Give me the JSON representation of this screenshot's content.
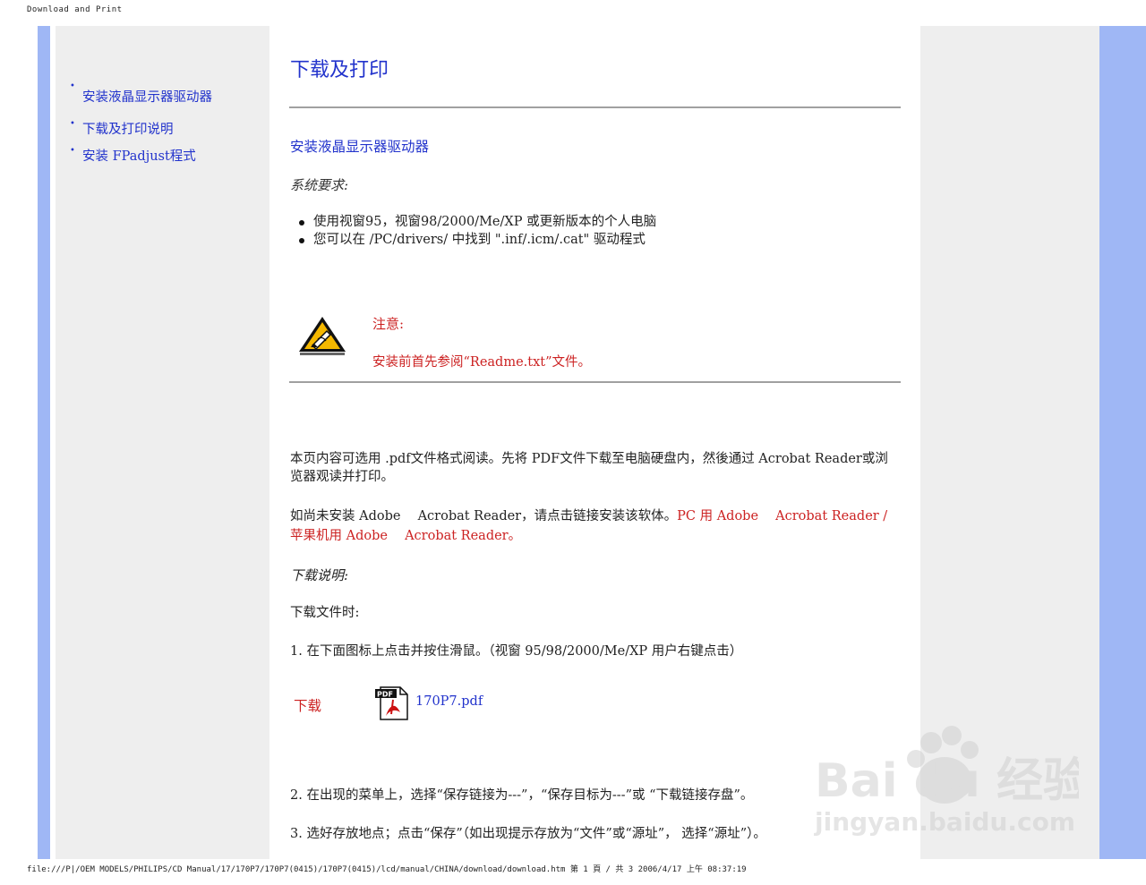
{
  "print_header": "Download and Print",
  "print_footer": "file:///P|/OEM MODELS/PHILIPS/CD Manual/17/170P7/170P7(0415)/170P7(0415)/lcd/manual/CHINA/download/download.htm 第 1 頁 / 共 3 2006/4/17 上午 08:37:19",
  "sidebar": {
    "items": [
      {
        "label": "安装液晶显示器驱动器"
      },
      {
        "label": "下载及打印说明"
      },
      {
        "label": "安装 FPadjust程式"
      }
    ]
  },
  "main": {
    "title": "下载及打印",
    "section_link": "安装液晶显示器驱动器",
    "system_req_label": "系统要求:",
    "requirements": [
      "使用视窗95，视窗98/2000/Me/XP 或更新版本的个人电脑",
      "您可以在 /PC/drivers/ 中找到 \".inf/.icm/.cat\" 驱动程式"
    ],
    "note_title": "注意:",
    "note_text": "安装前首先参阅“Readme.txt”文件。",
    "pdf_intro": "本页内容可选用 .pdf文件格式阅读。先将 PDF文件下载至电脑硬盘内，然後通过 Acrobat Reader或浏览器观读并打印。",
    "install_prefix": "如尚未安装 Adobe　 Acrobat Reader，请点击链接安装该软体。",
    "install_links": "PC 用 Adobe　 Acrobat Reader / 苹果机用 Adobe　 Acrobat Reader。",
    "download_notes_label": "下载说明:",
    "download_when": "下载文件时:",
    "step1": "1. 在下面图标上点击并按住滑鼠。（视窗 95/98/2000/Me/XP 用户右键点击）",
    "download_label": "下载",
    "pdf_filename": "170P7.pdf",
    "step2": "2. 在出现的菜单上，选择“保存链接为---”，“保存目标为---”或 “下载链接存盘”。",
    "step3": "3. 选好存放地点；点击“保存”（如出现提示存放为“文件”或“源址”， 选择“源址”）。"
  },
  "watermark": {
    "brand": "Bai du 经验",
    "url": "jingyan.baidu.com"
  },
  "colors": {
    "link_blue": "#2233cc",
    "note_red": "#cc2222",
    "side_blue": "#9fb7f5",
    "panel_gray": "#eeeeee"
  }
}
